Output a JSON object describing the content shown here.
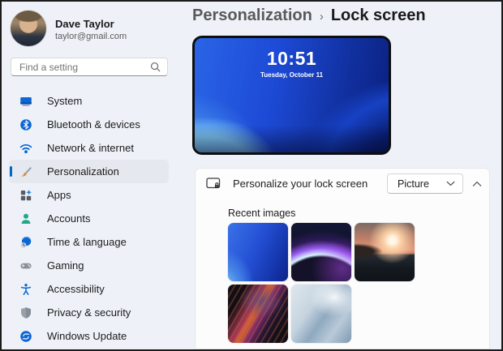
{
  "user": {
    "name": "Dave Taylor",
    "email": "taylor@gmail.com"
  },
  "search": {
    "placeholder": "Find a setting",
    "icon": "search-icon"
  },
  "sidebar": {
    "items": [
      {
        "label": "System",
        "icon": "system-icon",
        "selected": false
      },
      {
        "label": "Bluetooth & devices",
        "icon": "bluetooth-icon",
        "selected": false
      },
      {
        "label": "Network & internet",
        "icon": "network-icon",
        "selected": false
      },
      {
        "label": "Personalization",
        "icon": "personalization-icon",
        "selected": true
      },
      {
        "label": "Apps",
        "icon": "apps-icon",
        "selected": false
      },
      {
        "label": "Accounts",
        "icon": "accounts-icon",
        "selected": false
      },
      {
        "label": "Time & language",
        "icon": "time-language-icon",
        "selected": false
      },
      {
        "label": "Gaming",
        "icon": "gaming-icon",
        "selected": false
      },
      {
        "label": "Accessibility",
        "icon": "accessibility-icon",
        "selected": false
      },
      {
        "label": "Privacy & security",
        "icon": "privacy-security-icon",
        "selected": false
      },
      {
        "label": "Windows Update",
        "icon": "windows-update-icon",
        "selected": false
      }
    ]
  },
  "breadcrumb": {
    "parent": "Personalization",
    "separator": "›",
    "current": "Lock screen"
  },
  "lock_preview": {
    "time": "10:51",
    "date": "Tuesday, October 11"
  },
  "personalize_card": {
    "icon": "lock-screen-icon",
    "label": "Personalize your lock screen",
    "dropdown": {
      "value": "Picture",
      "icon": "chevron-down-icon"
    },
    "collapse_icon": "chevron-up-icon"
  },
  "recent_images": {
    "title": "Recent images",
    "thumbnails": [
      {
        "name": "windows-bloom-blue"
      },
      {
        "name": "dark-glowing-orb"
      },
      {
        "name": "sunset-over-water"
      },
      {
        "name": "magenta-abstract-swirls"
      },
      {
        "name": "light-blue-silk-waves"
      }
    ]
  },
  "colors": {
    "accent": "#0067c0",
    "window_bg": "#eef2f8",
    "card_bg": "#fdfdfe",
    "window_border": "#1b1b1b",
    "preview_blue": "#1d4ad6"
  }
}
